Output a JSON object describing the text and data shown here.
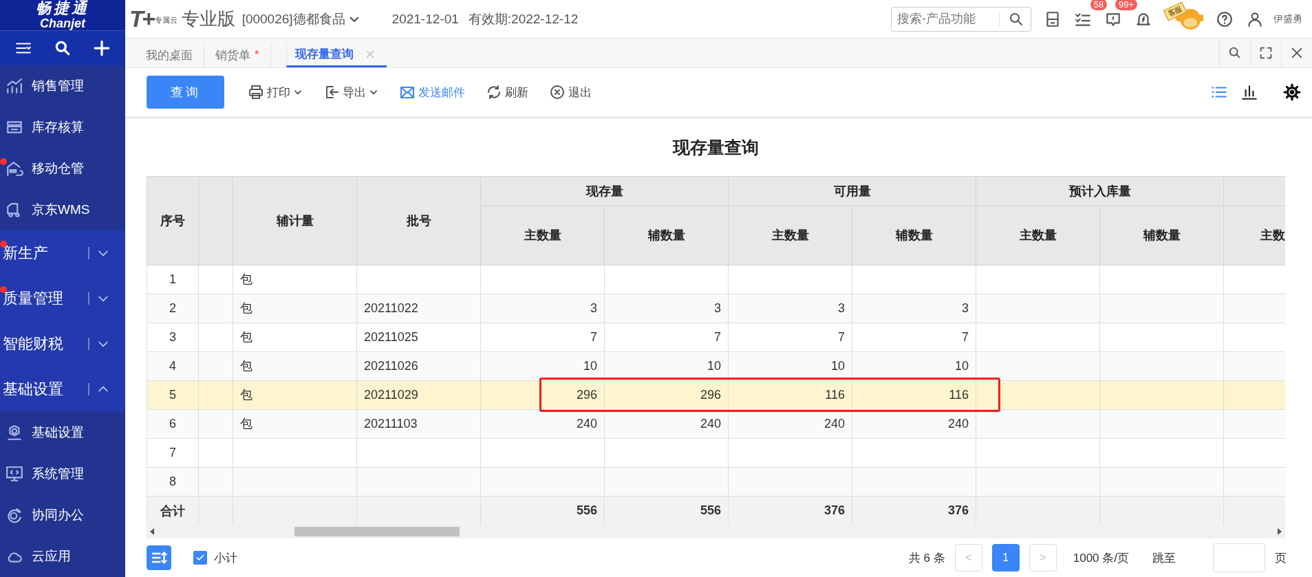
{
  "logo": {
    "name": "畅捷通",
    "latin": "Chanjet"
  },
  "header": {
    "product_mark": "T+",
    "product_sub": "专属云",
    "edition": "专业版",
    "company": "[000026]德都食品",
    "date": "2021-12-01",
    "validity": "有效期:2022-12-12",
    "search": {
      "placeholder": "搜索-产品功能"
    },
    "icons": [
      {
        "kind": "calculator"
      },
      {
        "kind": "tasks",
        "badge": "58"
      },
      {
        "kind": "message",
        "badge": "99+"
      },
      {
        "kind": "bell"
      },
      {
        "kind": "mascot",
        "label": "客服"
      },
      {
        "kind": "help"
      },
      {
        "kind": "user"
      }
    ],
    "user": "伊盛勇"
  },
  "sidebar": {
    "tools": [
      {
        "kind": "menu"
      },
      {
        "kind": "search"
      },
      {
        "kind": "add"
      }
    ],
    "items": [
      {
        "kind": "chart",
        "label": "销售管理",
        "dot": false
      },
      {
        "kind": "tray",
        "label": "库存核算",
        "dot": false
      },
      {
        "kind": "warehouse",
        "label": "移动仓管",
        "dot": true
      },
      {
        "kind": "truck",
        "label": "京东WMS",
        "dot": false
      },
      {
        "kind": "group",
        "label": "新生产",
        "dot": true,
        "expanded": false
      },
      {
        "kind": "group",
        "label": "质量管理",
        "dot": true,
        "expanded": false
      },
      {
        "kind": "group",
        "label": "智能财税",
        "dot": false,
        "expanded": false
      },
      {
        "kind": "group",
        "label": "基础设置",
        "dot": false,
        "expanded": true
      },
      {
        "kind": "gear",
        "label": "基础设置",
        "dot": false
      },
      {
        "kind": "monitor",
        "label": "系统管理",
        "dot": false
      },
      {
        "kind": "orbit",
        "label": "协同办公",
        "dot": false
      },
      {
        "kind": "cloud",
        "label": "云应用",
        "dot": false
      }
    ]
  },
  "tabs": [
    {
      "label": "我的桌面",
      "selected": false
    },
    {
      "label": "销货单",
      "mark": "*",
      "selected": false
    },
    {
      "label": "现存量查询",
      "selected": true,
      "closable": true
    }
  ],
  "toolbar": {
    "buttons": [
      {
        "kind": "primary",
        "label": "查询"
      },
      {
        "kind": "print",
        "label": "打印",
        "dropdown": true
      },
      {
        "kind": "export",
        "label": "导出",
        "dropdown": true
      },
      {
        "kind": "mail",
        "label": "发送邮件",
        "accent": true
      },
      {
        "kind": "refresh",
        "label": "刷新"
      },
      {
        "kind": "exit",
        "label": "退出"
      }
    ],
    "views": [
      {
        "kind": "list",
        "selected": true
      },
      {
        "kind": "bars",
        "selected": false
      }
    ]
  },
  "table": {
    "title": "现存量查询",
    "columns": [
      {
        "kind": "index",
        "label": "序号"
      },
      {
        "kind": "blank"
      },
      {
        "kind": "text",
        "label": "辅计量"
      },
      {
        "kind": "text",
        "label": "批号"
      },
      {
        "kind": "group",
        "label": "现存量",
        "colspan": 2,
        "columns": [
          {
            "label": "主数量"
          },
          {
            "label": "辅数量"
          }
        ]
      },
      {
        "kind": "group",
        "label": "可用量",
        "colspan": 2,
        "columns": [
          {
            "label": "主数量"
          },
          {
            "label": "辅数量"
          }
        ]
      },
      {
        "kind": "group",
        "label": "预计入库量",
        "colspan": 2,
        "columns": [
          {
            "label": "主数量"
          },
          {
            "label": "辅数量"
          }
        ]
      },
      {
        "kind": "group",
        "columns": [
          {
            "label": "主数"
          }
        ]
      }
    ],
    "rows": [
      {
        "cells": [
          "1",
          null,
          "包",
          null,
          null,
          null,
          null,
          null,
          null,
          null,
          null
        ],
        "selected": false,
        "boxed": false
      },
      {
        "cells": [
          "2",
          null,
          "包",
          "20211022",
          "3",
          "3",
          "3",
          "3",
          null,
          null,
          null
        ],
        "selected": false,
        "boxed": false
      },
      {
        "cells": [
          "3",
          null,
          "包",
          "20211025",
          "7",
          "7",
          "7",
          "7",
          null,
          null,
          null
        ],
        "selected": false,
        "boxed": false
      },
      {
        "cells": [
          "4",
          null,
          "包",
          "20211026",
          "10",
          "10",
          "10",
          "10",
          null,
          null,
          null
        ],
        "selected": false,
        "boxed": false
      },
      {
        "cells": [
          "5",
          null,
          "包",
          "20211029",
          "296",
          "296",
          "116",
          "116",
          null,
          null,
          null
        ],
        "selected": true,
        "boxed": true
      },
      {
        "cells": [
          "6",
          null,
          "包",
          "20211103",
          "240",
          "240",
          "240",
          "240",
          null,
          null,
          null
        ],
        "selected": false,
        "boxed": false
      },
      {
        "cells": [
          "7",
          null,
          null,
          null,
          null,
          null,
          null,
          null,
          null,
          null,
          null
        ],
        "selected": false,
        "boxed": false
      },
      {
        "cells": [
          "8",
          null,
          null,
          null,
          null,
          null,
          null,
          null,
          null,
          null,
          null
        ],
        "selected": false,
        "boxed": false
      }
    ],
    "total": {
      "cells": [
        "合计",
        null,
        null,
        null,
        "556",
        "556",
        "376",
        "376",
        null,
        null,
        null
      ]
    }
  },
  "footer": {
    "subtotal": {
      "label": "小计",
      "checked": true
    },
    "count": "共 6 条",
    "prev": "<",
    "pages": [
      {
        "label": "1",
        "selected": true
      }
    ],
    "next": ">",
    "page_size": "1000 条/页",
    "jump_label": "跳至",
    "jump_unit": "页"
  }
}
